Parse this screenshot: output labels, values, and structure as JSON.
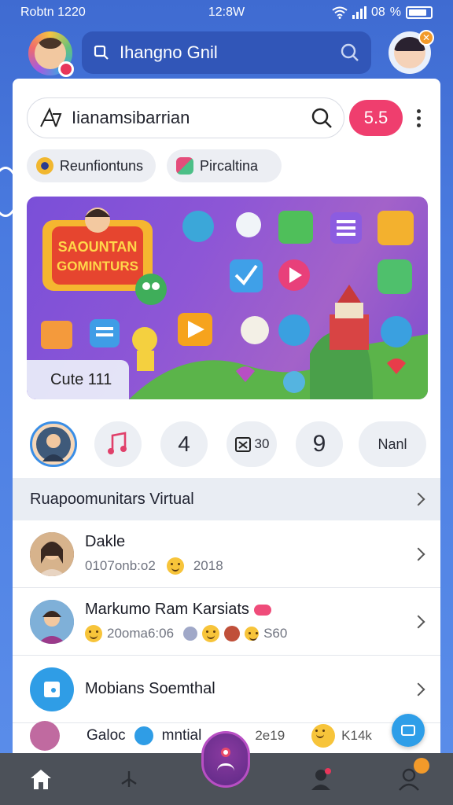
{
  "status_bar": {
    "left": "Robtn 1220",
    "time": "12:8W",
    "battery": "08"
  },
  "topbar": {
    "search_label": "Ihangno Gnil"
  },
  "search": {
    "value": "Iianamsibarrian",
    "count": "5.5"
  },
  "chips": [
    {
      "label": "Reunfiontuns"
    },
    {
      "label": "Pircaltina"
    }
  ],
  "banner": {
    "headline_1": "SAOUNTAN",
    "headline_2": "GOMINTURS",
    "caption": "Cute 111"
  },
  "quick_buttons": {
    "b3": "4",
    "b4": "30",
    "b5": "9",
    "b6": "Nanl"
  },
  "section": {
    "title": "Ruapoomunitars Virtual"
  },
  "list": [
    {
      "title": "Dakle",
      "sub_left": "0107onb:o2",
      "sub_right": "2018"
    },
    {
      "title": "Markumo  Ram Karsiats",
      "sub_left": "20oma6:06",
      "sub_right": "S60"
    },
    {
      "title": "Mobians Soemthal"
    }
  ],
  "partial_row": {
    "a": "Galoc",
    "b": "mntial",
    "c": "2e19",
    "d": "K14k"
  },
  "colors": {
    "accent": "#ef3e6e",
    "primary": "#3f6bd1",
    "nav": "#4c5159"
  }
}
